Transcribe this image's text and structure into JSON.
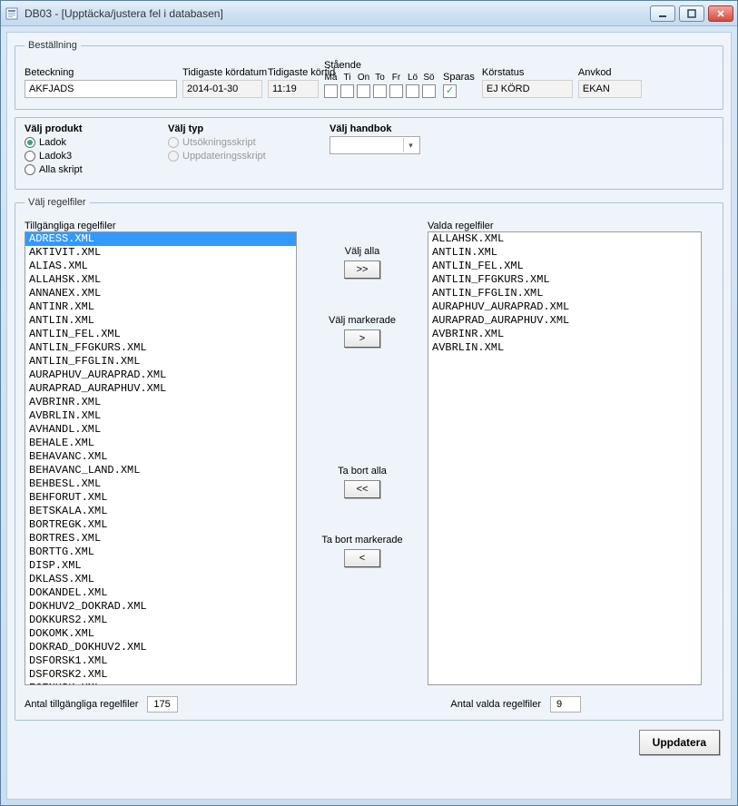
{
  "window": {
    "title": "DB03 - [Upptäcka/justera fel i databasen]"
  },
  "bestallning": {
    "legend": "Beställning",
    "labels": {
      "beteckning": "Beteckning",
      "tidigaste_kordatum": "Tidigaste kördatum",
      "tidigaste_kortid": "Tidigaste körtid",
      "staende": "Stående",
      "sparas": "Sparas",
      "korstatus": "Körstatus",
      "anvkod": "Anvkod"
    },
    "values": {
      "beteckning": "AKFJADS",
      "tidigaste_kordatum": "2014-01-30",
      "tidigaste_kortid": "11:19",
      "korstatus": "EJ KÖRD",
      "anvkod": "EKAN"
    },
    "days": [
      "Må",
      "Ti",
      "On",
      "To",
      "Fr",
      "Lö",
      "Sö"
    ],
    "days_checked": [
      false,
      false,
      false,
      false,
      false,
      false,
      false
    ],
    "sparas_checked": true
  },
  "produkt": {
    "legend_produkt": "Välj produkt",
    "legend_typ": "Välj typ",
    "legend_handbok": "Välj handbok",
    "options_produkt": [
      {
        "label": "Ladok",
        "checked": true
      },
      {
        "label": "Ladok3",
        "checked": false
      },
      {
        "label": "Alla skript",
        "checked": false
      }
    ],
    "options_typ": [
      {
        "label": "Utsökningsskript",
        "checked": false,
        "disabled": true
      },
      {
        "label": "Uppdateringsskript",
        "checked": false,
        "disabled": true
      }
    ]
  },
  "regelfiler": {
    "legend": "Välj regelfiler",
    "available_label": "Tillgängliga regelfiler",
    "selected_label": "Valda regelfiler",
    "buttons": {
      "select_all_label": "Välj alla",
      "select_all_sym": ">>",
      "select_marked_label": "Välj markerade",
      "select_marked_sym": ">",
      "remove_all_label": "Ta bort alla",
      "remove_all_sym": "<<",
      "remove_marked_label": "Ta bort markerade",
      "remove_marked_sym": "<"
    },
    "available_selected_index": 0,
    "available": [
      "ADRESS.XML",
      "AKTIVIT.XML",
      "ALIAS.XML",
      "ALLAHSK.XML",
      "ANNANEX.XML",
      "ANTINR.XML",
      "ANTLIN.XML",
      "ANTLIN_FEL.XML",
      "ANTLIN_FFGKURS.XML",
      "ANTLIN_FFGLIN.XML",
      "AURAPHUV_AURAPRAD.XML",
      "AURAPRAD_AURAPHUV.XML",
      "AVBRINR.XML",
      "AVBRLIN.XML",
      "AVHANDL.XML",
      "BEHALE.XML",
      "BEHAVANC.XML",
      "BEHAVANC_LAND.XML",
      "BEHBESL.XML",
      "BEHFORUT.XML",
      "BETSKALA.XML",
      "BORTREGK.XML",
      "BORTRES.XML",
      "BORTTG.XML",
      "DISP.XML",
      "DKLASS.XML",
      "DOKANDEL.XML",
      "DOKHUV2_DOKRAD.XML",
      "DOKKURS2.XML",
      "DOKOMK.XML",
      "DOKRAD_DOKHUV2.XML",
      "DSFORSK1.XML",
      "DSFORSK2.XML",
      "EGENHSK.XML"
    ],
    "selected": [
      "ALLAHSK.XML",
      "ANTLIN.XML",
      "ANTLIN_FEL.XML",
      "ANTLIN_FFGKURS.XML",
      "ANTLIN_FFGLIN.XML",
      "AURAPHUV_AURAPRAD.XML",
      "AURAPRAD_AURAPHUV.XML",
      "AVBRINR.XML",
      "AVBRLIN.XML"
    ],
    "count_available_label": "Antal tillgängliga regelfiler",
    "count_available": "175",
    "count_selected_label": "Antal valda regelfiler",
    "count_selected": "9"
  },
  "footer": {
    "update": "Uppdatera"
  }
}
